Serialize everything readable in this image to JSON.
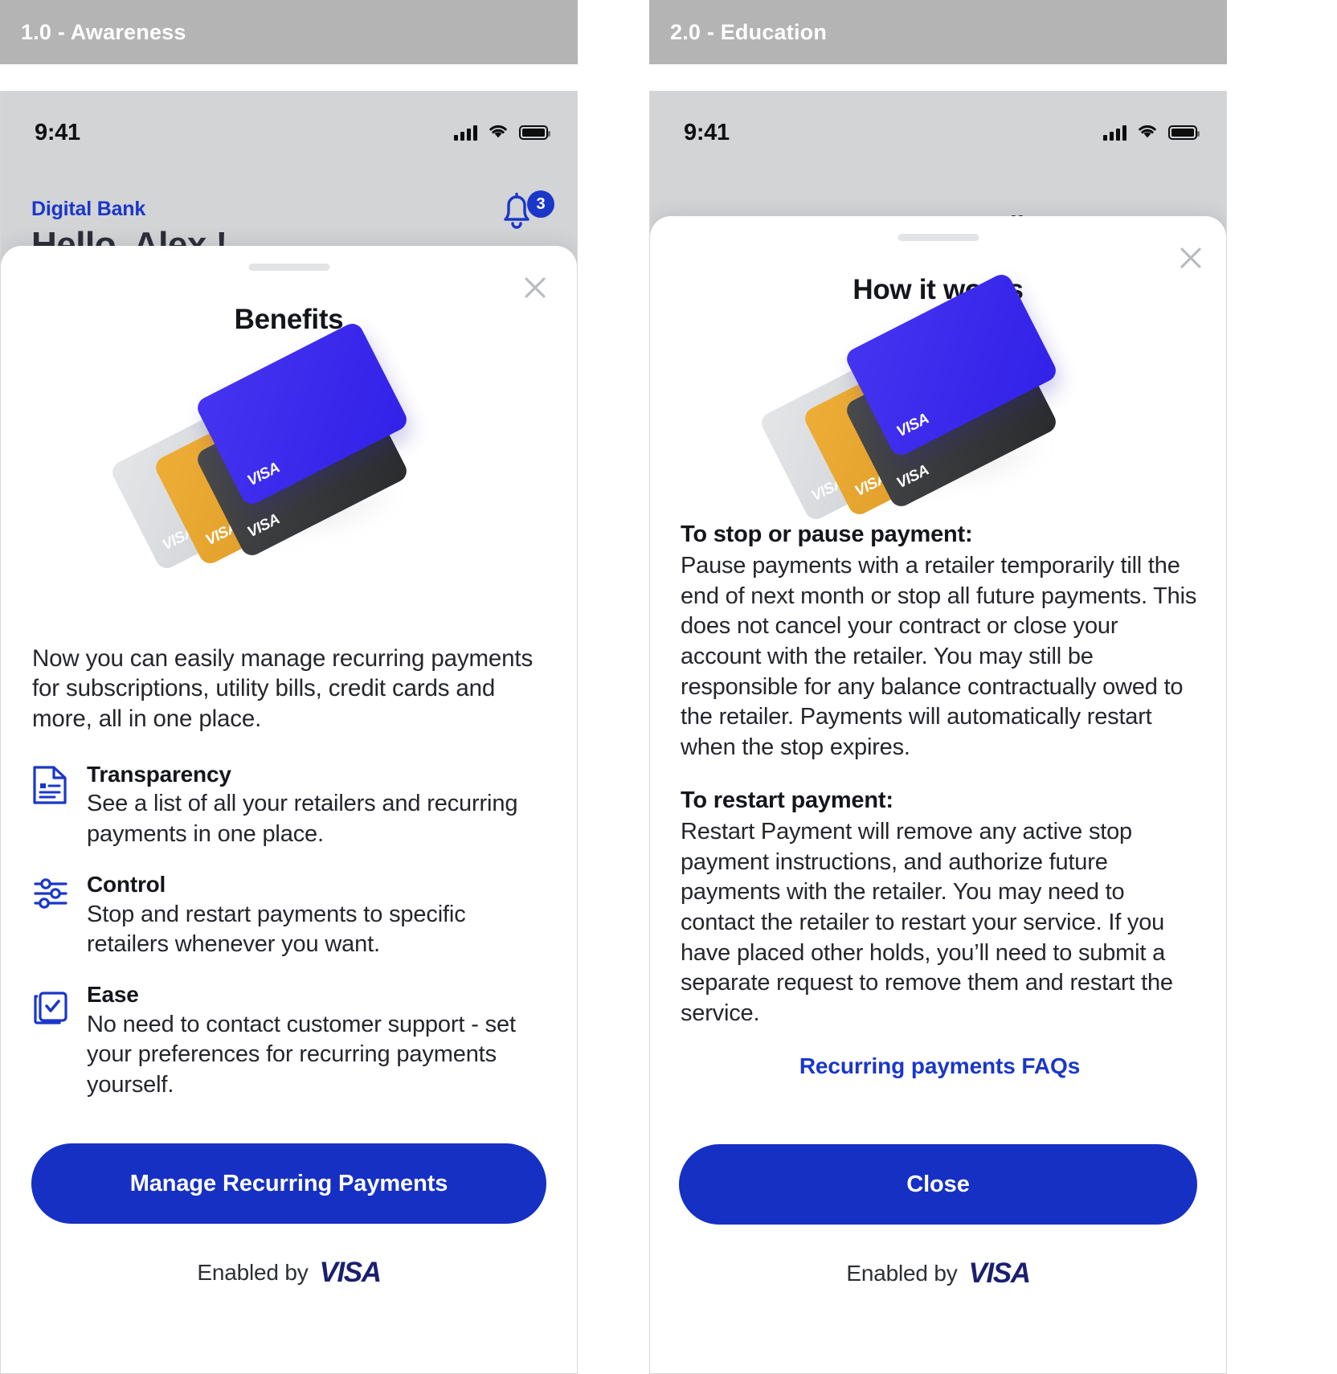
{
  "panels": [
    {
      "header_label": "1.0 - Awareness",
      "status_bar": {
        "time": "9:41",
        "signal_icon": "cellular-signal-icon",
        "wifi_icon": "wifi-icon",
        "battery_icon": "battery-icon"
      },
      "background_app": {
        "brand": "Digital Bank",
        "greeting": "Hello, Alex !",
        "bell_icon": "bell-icon",
        "notification_count": "3"
      },
      "sheet": {
        "grabber": "drag-handle",
        "close_icon": "close-icon",
        "title": "Benefits",
        "illustration": "visa-card-stack-illustration",
        "intro": "Now you can easily manage recurring payments for subscriptions, utility bills, credit cards and more, all in one place.",
        "features": [
          {
            "icon": "document-list-icon",
            "title": "Transparency",
            "desc": "See a list of all your retailers and recurring payments in one place."
          },
          {
            "icon": "sliders-control-icon",
            "title": "Control",
            "desc": "Stop and restart payments to specific retailers whenever you want."
          },
          {
            "icon": "checkbox-stack-icon",
            "title": "Ease",
            "desc": "No need to contact customer support - set your preferences for recurring payments yourself."
          }
        ],
        "cta_label": "Manage Recurring Payments",
        "footer_text": "Enabled by",
        "footer_logo": "VISA"
      }
    },
    {
      "header_label": "2.0 - Education",
      "status_bar": {
        "time": "9:41",
        "signal_icon": "cellular-signal-icon",
        "wifi_icon": "wifi-icon",
        "battery_icon": "battery-icon"
      },
      "background_app": {
        "back_icon": "back-chevron-icon",
        "nav_title": "Payment Details"
      },
      "sheet": {
        "grabber": "drag-handle",
        "close_icon": "close-icon",
        "title": "How it works",
        "illustration": "visa-card-stack-illustration",
        "sections": [
          {
            "heading": "To stop or pause payment:",
            "body": "Pause payments with a retailer temporarily till the end of next month or stop all future payments. This does not cancel your contract or close your account with the retailer. You may still be responsible for any balance contractually owed to the retailer. Payments will automatically restart when the stop expires."
          },
          {
            "heading": "To restart payment:",
            "body": "Restart Payment will remove any active stop payment instructions, and authorize future payments with the retailer. You may need to contact the retailer to restart your service. If you have placed other holds, you’ll need to submit a separate request to remove them and restart the service."
          }
        ],
        "faq_link": "Recurring payments FAQs",
        "cta_label": "Close",
        "footer_text": "Enabled by",
        "footer_logo": "VISA"
      }
    }
  ],
  "colors": {
    "brand_blue": "#1630c4",
    "link_blue": "#1a37c9",
    "visa_navy": "#1434cb",
    "header_gray": "#b4b4b4",
    "card_blue": "#3221e8",
    "card_gold": "#e0a12c",
    "card_dark": "#333436",
    "card_silver": "#d5d8db"
  }
}
